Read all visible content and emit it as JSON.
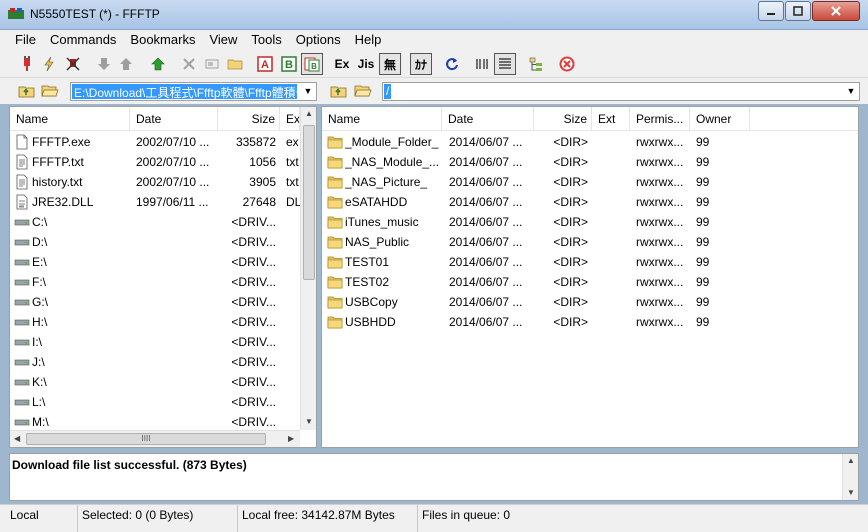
{
  "window": {
    "title": "N5550TEST (*) - FFFTP",
    "icon": "ffftp-app-icon",
    "controls": {
      "minimize": "_",
      "maximize": "□",
      "close": "✕"
    }
  },
  "menu": [
    "File",
    "Commands",
    "Bookmarks",
    "View",
    "Tools",
    "Options",
    "Help"
  ],
  "toolbar": {
    "ex_label": "Ex",
    "js_label": "Jis",
    "no_kana_label": "無",
    "kana_label": "ｶﾅ"
  },
  "local": {
    "path": "E:\\Download\\工具程式\\Ffftp軟體\\Ffftp體積奇小速度奇快",
    "headers": {
      "name": "Name",
      "date": "Date",
      "size": "Size",
      "ext": "Ext"
    },
    "files": [
      {
        "icon": "exe-file-icon",
        "name": "FFFTP.exe",
        "date": "2002/07/10 ...",
        "size": "335872",
        "ext": "ex"
      },
      {
        "icon": "text-file-icon",
        "name": "FFFTP.txt",
        "date": "2002/07/10 ...",
        "size": "1056",
        "ext": "txt"
      },
      {
        "icon": "text-file-icon",
        "name": "history.txt",
        "date": "2002/07/10 ...",
        "size": "3905",
        "ext": "txt"
      },
      {
        "icon": "dll-file-icon",
        "name": "JRE32.DLL",
        "date": "1997/06/11 ...",
        "size": "27648",
        "ext": "DL"
      },
      {
        "icon": "drive-icon",
        "name": "C:\\",
        "date": "",
        "size": "<DRIV...",
        "ext": ""
      },
      {
        "icon": "drive-icon",
        "name": "D:\\",
        "date": "",
        "size": "<DRIV...",
        "ext": ""
      },
      {
        "icon": "drive-icon",
        "name": "E:\\",
        "date": "",
        "size": "<DRIV...",
        "ext": ""
      },
      {
        "icon": "drive-icon",
        "name": "F:\\",
        "date": "",
        "size": "<DRIV...",
        "ext": ""
      },
      {
        "icon": "drive-icon",
        "name": "G:\\",
        "date": "",
        "size": "<DRIV...",
        "ext": ""
      },
      {
        "icon": "drive-icon",
        "name": "H:\\",
        "date": "",
        "size": "<DRIV...",
        "ext": ""
      },
      {
        "icon": "drive-icon",
        "name": "I:\\",
        "date": "",
        "size": "<DRIV...",
        "ext": ""
      },
      {
        "icon": "drive-icon",
        "name": "J:\\",
        "date": "",
        "size": "<DRIV...",
        "ext": ""
      },
      {
        "icon": "drive-icon",
        "name": "K:\\",
        "date": "",
        "size": "<DRIV...",
        "ext": ""
      },
      {
        "icon": "drive-icon",
        "name": "L:\\",
        "date": "",
        "size": "<DRIV...",
        "ext": ""
      },
      {
        "icon": "drive-icon",
        "name": "M:\\",
        "date": "",
        "size": "<DRIV...",
        "ext": ""
      }
    ],
    "hscroll_grip": "IIII"
  },
  "remote": {
    "path": "/",
    "headers": {
      "name": "Name",
      "date": "Date",
      "size": "Size",
      "ext": "Ext",
      "perm": "Permis...",
      "owner": "Owner"
    },
    "files": [
      {
        "name": "_Module_Folder_",
        "date": "2014/06/07 ...",
        "size": "<DIR>",
        "ext": "",
        "perm": "rwxrwx...",
        "owner": "99"
      },
      {
        "name": "_NAS_Module_...",
        "date": "2014/06/07 ...",
        "size": "<DIR>",
        "ext": "",
        "perm": "rwxrwx...",
        "owner": "99"
      },
      {
        "name": "_NAS_Picture_",
        "date": "2014/06/07 ...",
        "size": "<DIR>",
        "ext": "",
        "perm": "rwxrwx...",
        "owner": "99"
      },
      {
        "name": "eSATAHDD",
        "date": "2014/06/07 ...",
        "size": "<DIR>",
        "ext": "",
        "perm": "rwxrwx...",
        "owner": "99"
      },
      {
        "name": "iTunes_music",
        "date": "2014/06/07 ...",
        "size": "<DIR>",
        "ext": "",
        "perm": "rwxrwx...",
        "owner": "99"
      },
      {
        "name": "NAS_Public",
        "date": "2014/06/07 ...",
        "size": "<DIR>",
        "ext": "",
        "perm": "rwxrwx...",
        "owner": "99"
      },
      {
        "name": "TEST01",
        "date": "2014/06/07 ...",
        "size": "<DIR>",
        "ext": "",
        "perm": "rwxrwx...",
        "owner": "99"
      },
      {
        "name": "TEST02",
        "date": "2014/06/07 ...",
        "size": "<DIR>",
        "ext": "",
        "perm": "rwxrwx...",
        "owner": "99"
      },
      {
        "name": "USBCopy",
        "date": "2014/06/07 ...",
        "size": "<DIR>",
        "ext": "",
        "perm": "rwxrwx...",
        "owner": "99"
      },
      {
        "name": "USBHDD",
        "date": "2014/06/07 ...",
        "size": "<DIR>",
        "ext": "",
        "perm": "rwxrwx...",
        "owner": "99"
      }
    ]
  },
  "log": {
    "message": "Download file list successful. (873 Bytes)"
  },
  "status": {
    "mode": "Local",
    "selected": "Selected: 0 (0 Bytes)",
    "free": "Local free: 34142.87M Bytes",
    "queue": "Files in queue: 0"
  },
  "colors": {
    "selection": "#3399ff",
    "folder": "#e8c25a",
    "title_gradient_top": "#c8daf0"
  }
}
